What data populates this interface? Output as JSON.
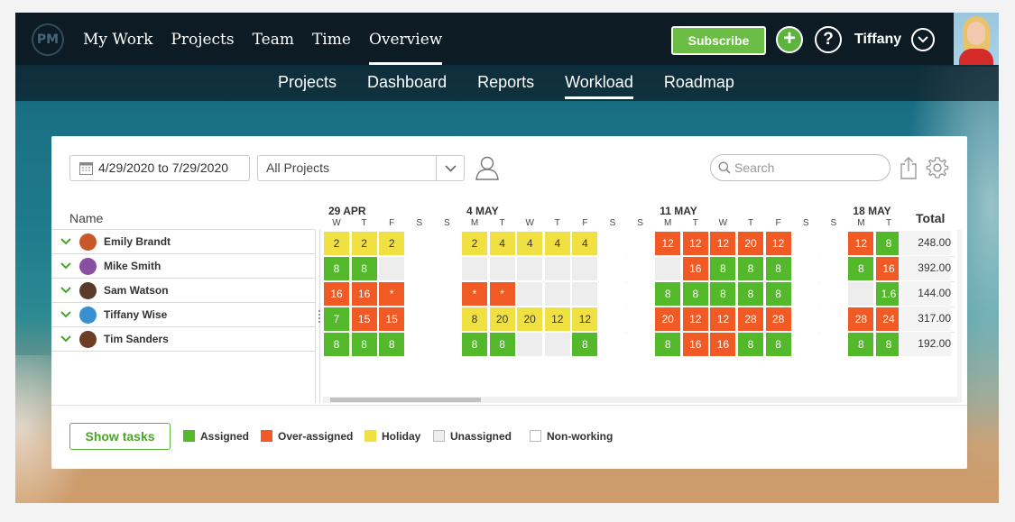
{
  "app": {
    "logo_text": "PM"
  },
  "main_nav": [
    "My Work",
    "Projects",
    "Team",
    "Time",
    "Overview"
  ],
  "main_nav_active": "Overview",
  "header": {
    "subscribe_label": "Subscribe",
    "user_name": "Tiffany"
  },
  "sub_nav": [
    "Projects",
    "Dashboard",
    "Reports",
    "Workload",
    "Roadmap"
  ],
  "sub_nav_active": "Workload",
  "toolbar": {
    "date_range": "4/29/2020 to 7/29/2020",
    "project_filter": "All Projects",
    "search_placeholder": "Search"
  },
  "grid": {
    "name_header": "Name",
    "total_header": "Total",
    "weeks": [
      "29 APR",
      "4 MAY",
      "11 MAY",
      "18 MAY"
    ],
    "day_letters": [
      "W",
      "T",
      "F",
      "S",
      "S",
      "M",
      "T",
      "W",
      "T",
      "F",
      "S",
      "S",
      "M",
      "T",
      "W",
      "T",
      "F",
      "S",
      "S",
      "M",
      "T"
    ],
    "rows": [
      {
        "name": "Emily Brandt",
        "avatar_color": "#c9572a",
        "total": "248.00",
        "cells": [
          [
            "h",
            "2"
          ],
          [
            "h",
            "2"
          ],
          [
            "h",
            "2"
          ],
          [
            "n",
            ""
          ],
          [
            "n",
            ""
          ],
          [
            "h",
            "2"
          ],
          [
            "h",
            "4"
          ],
          [
            "h",
            "4"
          ],
          [
            "h",
            "4"
          ],
          [
            "h",
            "4"
          ],
          [
            "n",
            ""
          ],
          [
            "n",
            ""
          ],
          [
            "o",
            "12"
          ],
          [
            "o",
            "12"
          ],
          [
            "o",
            "12"
          ],
          [
            "o",
            "20"
          ],
          [
            "o",
            "12"
          ],
          [
            "n",
            ""
          ],
          [
            "n",
            ""
          ],
          [
            "o",
            "12"
          ],
          [
            "a",
            "8"
          ]
        ]
      },
      {
        "name": "Mike Smith",
        "avatar_color": "#8a4fa3",
        "total": "392.00",
        "cells": [
          [
            "a",
            "8"
          ],
          [
            "a",
            "8"
          ],
          [
            "u",
            ""
          ],
          [
            "n",
            ""
          ],
          [
            "n",
            ""
          ],
          [
            "u",
            ""
          ],
          [
            "u",
            ""
          ],
          [
            "u",
            ""
          ],
          [
            "u",
            ""
          ],
          [
            "u",
            ""
          ],
          [
            "n",
            ""
          ],
          [
            "n",
            ""
          ],
          [
            "u",
            ""
          ],
          [
            "o",
            "16"
          ],
          [
            "a",
            "8"
          ],
          [
            "a",
            "8"
          ],
          [
            "a",
            "8"
          ],
          [
            "n",
            ""
          ],
          [
            "n",
            ""
          ],
          [
            "a",
            "8"
          ],
          [
            "o",
            "16"
          ]
        ]
      },
      {
        "name": "Sam Watson",
        "avatar_color": "#5a3a2a",
        "total": "144.00",
        "cells": [
          [
            "o",
            "16"
          ],
          [
            "o",
            "16"
          ],
          [
            "o",
            "*"
          ],
          [
            "n",
            ""
          ],
          [
            "n",
            ""
          ],
          [
            "o",
            "*"
          ],
          [
            "o",
            "*"
          ],
          [
            "u",
            ""
          ],
          [
            "u",
            ""
          ],
          [
            "u",
            ""
          ],
          [
            "n",
            ""
          ],
          [
            "n",
            ""
          ],
          [
            "a",
            "8"
          ],
          [
            "a",
            "8"
          ],
          [
            "a",
            "8"
          ],
          [
            "a",
            "8"
          ],
          [
            "a",
            "8"
          ],
          [
            "n",
            ""
          ],
          [
            "n",
            ""
          ],
          [
            "u",
            ""
          ],
          [
            "a",
            "1.6"
          ]
        ]
      },
      {
        "name": "Tiffany Wise",
        "avatar_color": "#3a8fd0",
        "total": "317.00",
        "cells": [
          [
            "a",
            "7"
          ],
          [
            "o",
            "15"
          ],
          [
            "o",
            "15"
          ],
          [
            "n",
            ""
          ],
          [
            "n",
            ""
          ],
          [
            "h",
            "8"
          ],
          [
            "h",
            "20"
          ],
          [
            "h",
            "20"
          ],
          [
            "h",
            "12"
          ],
          [
            "h",
            "12"
          ],
          [
            "n",
            ""
          ],
          [
            "n",
            ""
          ],
          [
            "o",
            "20"
          ],
          [
            "o",
            "12"
          ],
          [
            "o",
            "12"
          ],
          [
            "o",
            "28"
          ],
          [
            "o",
            "28"
          ],
          [
            "n",
            ""
          ],
          [
            "n",
            ""
          ],
          [
            "o",
            "28"
          ],
          [
            "o",
            "24"
          ]
        ]
      },
      {
        "name": "Tim Sanders",
        "avatar_color": "#6b3e25",
        "total": "192.00",
        "cells": [
          [
            "a",
            "8"
          ],
          [
            "a",
            "8"
          ],
          [
            "a",
            "8"
          ],
          [
            "n",
            ""
          ],
          [
            "n",
            ""
          ],
          [
            "a",
            "8"
          ],
          [
            "a",
            "8"
          ],
          [
            "u",
            ""
          ],
          [
            "u",
            ""
          ],
          [
            "a",
            "8"
          ],
          [
            "n",
            ""
          ],
          [
            "n",
            ""
          ],
          [
            "a",
            "8"
          ],
          [
            "o",
            "16"
          ],
          [
            "o",
            "16"
          ],
          [
            "a",
            "8"
          ],
          [
            "a",
            "8"
          ],
          [
            "n",
            ""
          ],
          [
            "n",
            ""
          ],
          [
            "a",
            "8"
          ],
          [
            "a",
            "8"
          ]
        ]
      }
    ]
  },
  "legend": {
    "show_tasks_label": "Show tasks",
    "items": [
      {
        "label": "Assigned",
        "color": "#53b82a"
      },
      {
        "label": "Over-assigned",
        "color": "#f15a24"
      },
      {
        "label": "Holiday",
        "color": "#f0e041"
      },
      {
        "label": "Unassigned",
        "color": "#ededed"
      },
      {
        "label": "Non-working",
        "color": "#ffffff"
      }
    ]
  }
}
